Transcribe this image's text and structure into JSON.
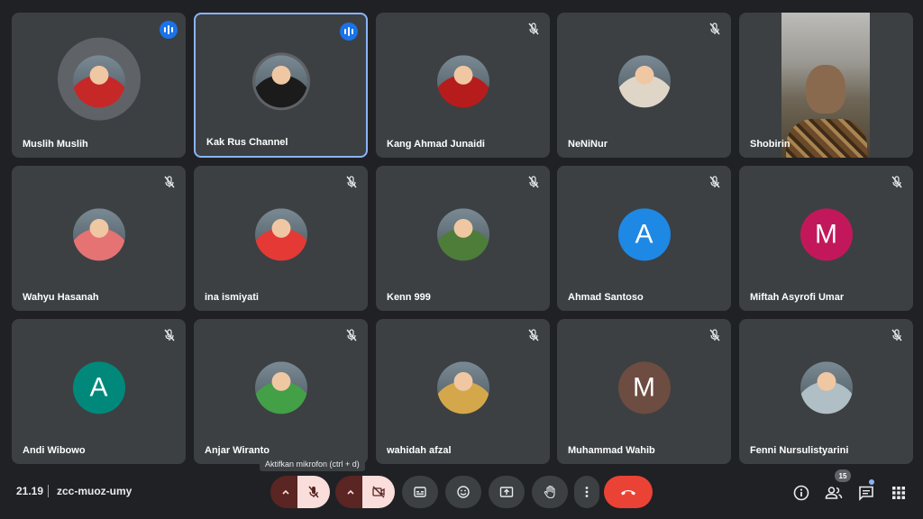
{
  "participants": [
    {
      "name": "Muslih Muslih",
      "state": "speaking",
      "avatar": "photo",
      "color": "#c62828"
    },
    {
      "name": "Kak Rus Channel",
      "state": "speaking",
      "avatar": "photo",
      "color": "#1b1b1b",
      "active": true
    },
    {
      "name": "Kang Ahmad Junaidi",
      "state": "muted",
      "avatar": "photo",
      "color": "#b71c1c"
    },
    {
      "name": "NeNiNur",
      "state": "muted",
      "avatar": "photo",
      "color": "#e0d6c8"
    },
    {
      "name": "Shobirin",
      "state": "video",
      "avatar": "video",
      "color": "#8a6a4e"
    },
    {
      "name": "Wahyu Hasanah",
      "state": "muted",
      "avatar": "photo",
      "color": "#e57373"
    },
    {
      "name": "ina ismiyati",
      "state": "muted",
      "avatar": "photo",
      "color": "#e53935"
    },
    {
      "name": "Kenn 999",
      "state": "muted",
      "avatar": "photo",
      "color": "#4e7d3a"
    },
    {
      "name": "Ahmad Santoso",
      "state": "muted",
      "avatar": "letter",
      "letter": "A",
      "color": "#1e88e5"
    },
    {
      "name": "Miftah Asyrofi Umar",
      "state": "muted",
      "avatar": "letter",
      "letter": "M",
      "color": "#c2185b"
    },
    {
      "name": "Andi Wibowo",
      "state": "muted",
      "avatar": "letter",
      "letter": "A",
      "color": "#00897b"
    },
    {
      "name": "Anjar Wiranto",
      "state": "muted",
      "avatar": "photo",
      "color": "#43a047"
    },
    {
      "name": "wahidah afzal",
      "state": "muted",
      "avatar": "photo",
      "color": "#d4a84a"
    },
    {
      "name": "Muhammad Wahib",
      "state": "muted",
      "avatar": "letter",
      "letter": "M",
      "color": "#6d4c41"
    },
    {
      "name": "Fenni Nursulistyarini",
      "state": "muted",
      "avatar": "photo",
      "color": "#b0bec5"
    }
  ],
  "bottom": {
    "time": "21.19",
    "meeting_code": "zcc-muoz-umy",
    "tooltip": "Aktifkan mikrofon (ctrl + d)",
    "participant_count": "15"
  },
  "icons": {
    "mic": "mic-off-icon",
    "camera": "camera-off-icon",
    "captions": "captions-icon",
    "emoji": "emoji-icon",
    "present": "present-screen-icon",
    "hand": "raise-hand-icon",
    "more": "more-options-icon",
    "hangup": "hang-up-icon",
    "info": "info-icon",
    "people": "people-icon",
    "chat": "chat-icon",
    "activities": "activities-icon"
  },
  "colors": {
    "background": "#202124",
    "tile": "#3c4043",
    "hangup": "#ea4335",
    "active_border": "#8ab4f8",
    "speaking": "#1a73e8"
  }
}
